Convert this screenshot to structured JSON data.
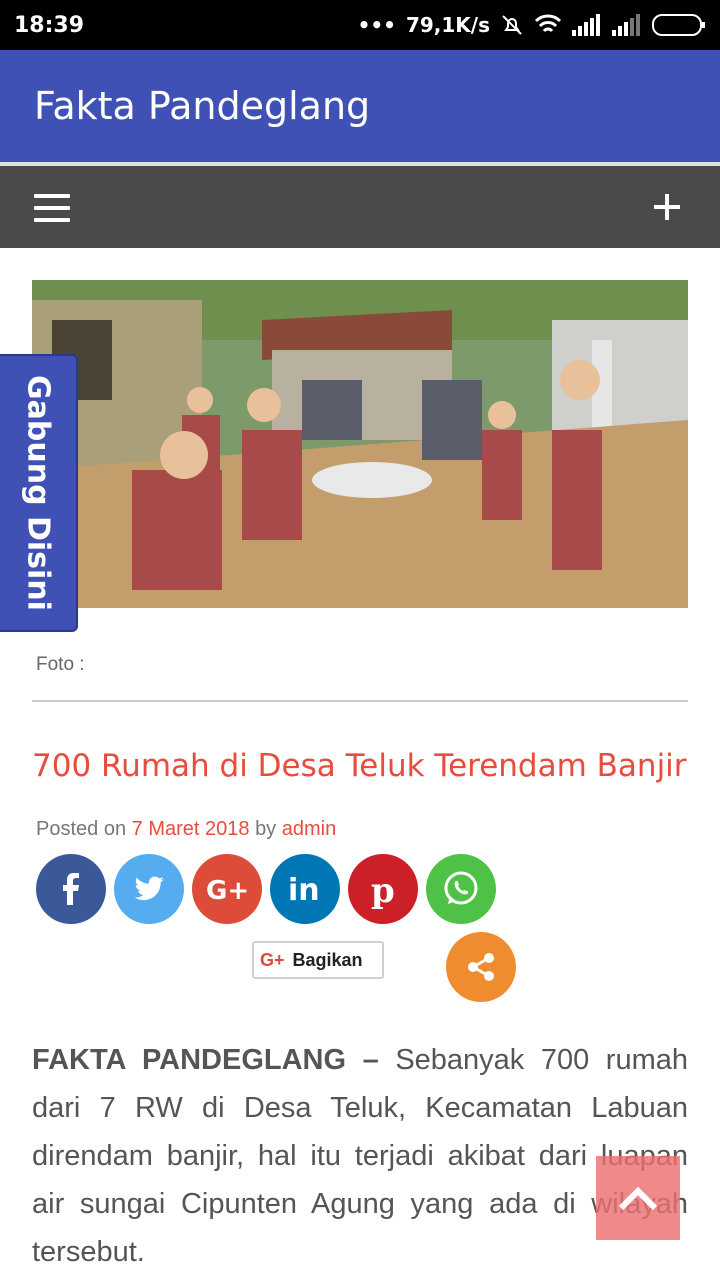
{
  "status_bar": {
    "time": "18:39",
    "network_speed": "79,1K/s",
    "icons": [
      "dots-icon",
      "mute-bell-icon",
      "wifi-icon",
      "signal-icon",
      "signal-icon-2",
      "battery-icon"
    ]
  },
  "app_bar": {
    "title": "Fakta Pandeglang"
  },
  "nav_bar": {
    "menu_icon": "hamburger-icon",
    "expand_icon": "plus-icon"
  },
  "side_tab": {
    "label": "Gabung Disini"
  },
  "article": {
    "photo_caption": "Foto :",
    "title": "700 Rumah di Desa Teluk Terendam Banjir",
    "posted_prefix": "Posted on",
    "date": "7 Maret 2018",
    "by_prefix": "by",
    "author": "admin",
    "body_lead": "FAKTA PANDEGLANG –",
    "body_text": "Sebanyak 700 rumah dari 7 RW di Desa Teluk, Kecamatan Labuan direndam banjir, hal itu terjadi akibat dari luapan air sungai Cipunten Agung yang ada di wilayah tersebut."
  },
  "share": {
    "buttons": [
      {
        "name": "facebook",
        "icon": "facebook-icon",
        "color": "#3b5998"
      },
      {
        "name": "twitter",
        "icon": "twitter-icon",
        "color": "#55acee"
      },
      {
        "name": "google-plus",
        "icon": "google-plus-icon",
        "color": "#dd4b39"
      },
      {
        "name": "linkedin",
        "icon": "linkedin-icon",
        "color": "#0077b5"
      },
      {
        "name": "pinterest",
        "icon": "pinterest-icon",
        "color": "#cb2027"
      },
      {
        "name": "whatsapp",
        "icon": "whatsapp-icon",
        "color": "#4dc247"
      }
    ],
    "gplus_icon_text": "G+",
    "gplus_label": "Bagikan",
    "more_icon": "share-icon",
    "more_color": "#ef8c2f"
  },
  "back_to_top": {
    "icon": "chevron-up-icon"
  },
  "colors": {
    "primary": "#3f51b5",
    "nav": "#4a4a4a",
    "accent": "#e74c3c"
  }
}
